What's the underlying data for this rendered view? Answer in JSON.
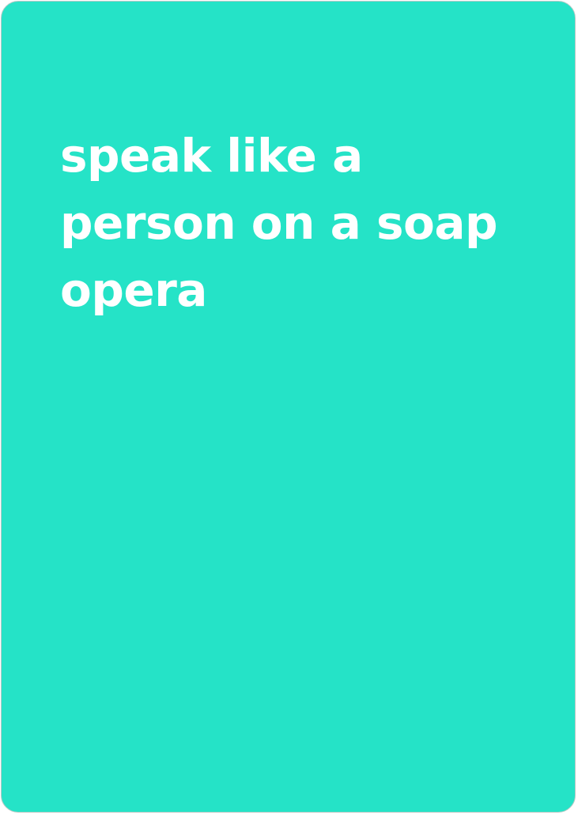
{
  "card": {
    "prompt": "speak like a person on a soap opera",
    "background_color": "#25e3c7",
    "text_color": "#ffffff"
  }
}
